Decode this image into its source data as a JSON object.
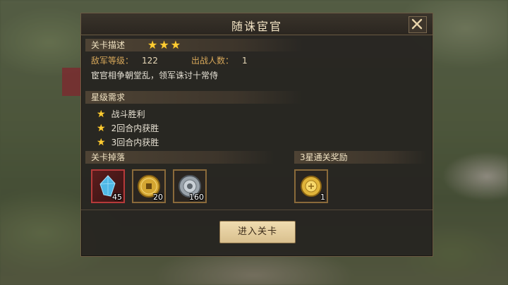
{
  "dialog": {
    "title": "随诛宦官",
    "close_icon": "close-x-icon"
  },
  "stage": {
    "desc_heading": "关卡描述",
    "stars": 3,
    "enemy_level_label": "敌军等级：",
    "enemy_level": "122",
    "deploy_label": "出战人数：",
    "deploy_count": "1",
    "description": "宦官相争朝堂乱，领军诛讨十常侍"
  },
  "star_requirements": {
    "heading": "星级需求",
    "items": [
      "战斗胜利",
      "2回合内获胜",
      "3回合内获胜"
    ]
  },
  "drops": {
    "heading": "关卡掉落",
    "items": [
      {
        "icon": "blue-crystal-icon",
        "count": "45"
      },
      {
        "icon": "gold-coin-icon",
        "count": "20"
      },
      {
        "icon": "silver-coin-icon",
        "count": "160"
      }
    ]
  },
  "reward": {
    "heading": "3星通关奖励",
    "items": [
      {
        "icon": "gold-medal-icon",
        "count": "1"
      }
    ]
  },
  "actions": {
    "enter_label": "进入关卡"
  },
  "colors": {
    "star": "#ffcc33",
    "label": "#d8a85a",
    "button_bg": "#e6cd9c"
  }
}
